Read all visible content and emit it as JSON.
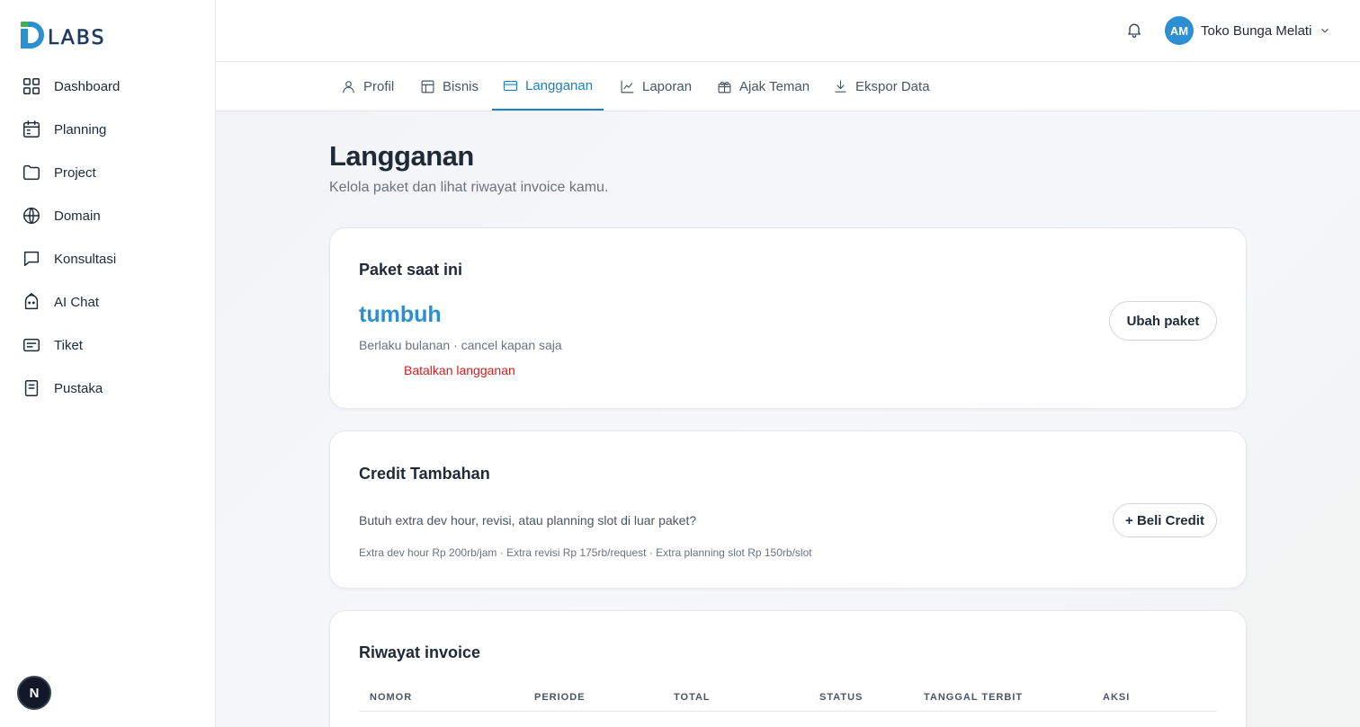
{
  "brand": {
    "logo_text": "LABS",
    "primary": "#2b8fd1",
    "accent_green": "#3cb34a"
  },
  "sidebar": {
    "items": [
      {
        "label": "Dashboard",
        "icon": "grid-icon"
      },
      {
        "label": "Planning",
        "icon": "calendar-icon"
      },
      {
        "label": "Project",
        "icon": "folder-icon"
      },
      {
        "label": "Domain",
        "icon": "globe-icon"
      },
      {
        "label": "Konsultasi",
        "icon": "chat-icon"
      },
      {
        "label": "AI Chat",
        "icon": "bot-icon"
      },
      {
        "label": "Tiket",
        "icon": "ticket-icon"
      },
      {
        "label": "Pustaka",
        "icon": "book-icon"
      }
    ],
    "fab_label": "N"
  },
  "header": {
    "avatar_initials": "AM",
    "user_name": "Toko Bunga Melati"
  },
  "tabs": [
    {
      "label": "Profil",
      "icon": "user-icon",
      "active": false
    },
    {
      "label": "Bisnis",
      "icon": "layout-icon",
      "active": false
    },
    {
      "label": "Langganan",
      "icon": "credit-card-icon",
      "active": true
    },
    {
      "label": "Laporan",
      "icon": "chart-icon",
      "active": false
    },
    {
      "label": "Ajak Teman",
      "icon": "gift-icon",
      "active": false
    },
    {
      "label": "Ekspor Data",
      "icon": "download-icon",
      "active": false
    }
  ],
  "page": {
    "title": "Langganan",
    "subtitle": "Kelola paket dan lihat riwayat invoice kamu."
  },
  "current_plan": {
    "title": "Paket saat ini",
    "plan_name": "tumbuh",
    "description": "Berlaku bulanan · cancel kapan saja",
    "cancel_label": "Batalkan langganan",
    "change_label": "Ubah paket"
  },
  "credit": {
    "title": "Credit Tambahan",
    "description": "Butuh extra dev hour, revisi, atau planning slot di luar paket?",
    "note": "Extra dev hour Rp 200rb/jam · Extra revisi Rp 175rb/request · Extra planning slot Rp 150rb/slot",
    "buy_label": "+ Beli Credit"
  },
  "invoices": {
    "title": "Riwayat invoice",
    "columns": [
      "NOMOR",
      "PERIODE",
      "TOTAL",
      "STATUS",
      "TANGGAL TERBIT",
      "AKSI"
    ]
  }
}
